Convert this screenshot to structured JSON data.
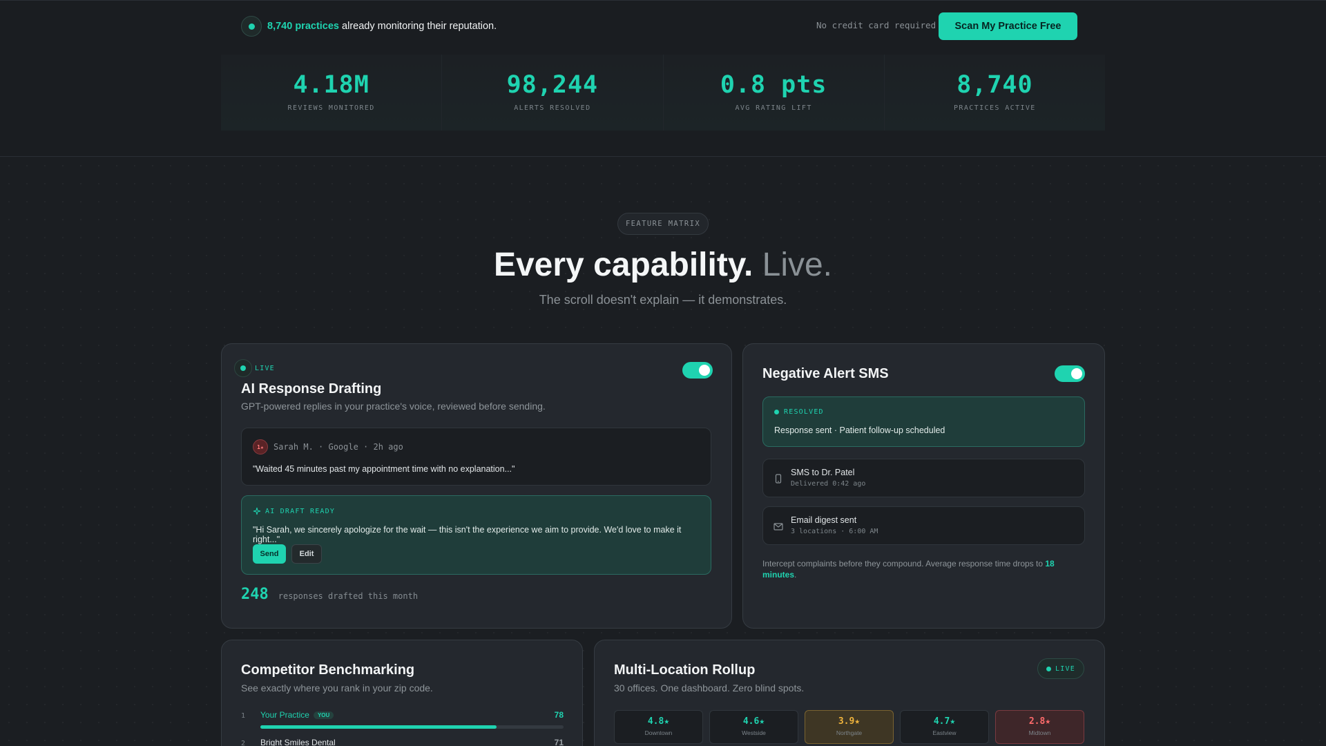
{
  "banner": {
    "practices_highlight": "8,740 practices",
    "practices_text": " already monitoring their reputation.",
    "no_card": "No credit card required",
    "cta": "Scan My Practice Free"
  },
  "stats": [
    {
      "value": "4.18M",
      "label": "REVIEWS MONITORED"
    },
    {
      "value": "98,244",
      "label": "ALERTS RESOLVED"
    },
    {
      "value": "0.8 pts",
      "label": "AVG RATING LIFT"
    },
    {
      "value": "8,740",
      "label": "PRACTICES ACTIVE"
    }
  ],
  "section": {
    "pill": "FEATURE MATRIX",
    "title_main": "Every capability.",
    "title_dim": " Live.",
    "subtitle": "The scroll doesn't explain — it demonstrates."
  },
  "ai_card": {
    "live": "LIVE",
    "title": "AI Response Drafting",
    "desc": "GPT-powered replies in your practice's voice, reviewed before sending.",
    "toggle_on": true,
    "review": {
      "avatar": "1★",
      "meta": "Sarah M. · Google · 2h ago",
      "quote": "\"Waited 45 minutes past my appointment time with no explanation...\""
    },
    "draft": {
      "header": "AI DRAFT READY",
      "text": "\"Hi Sarah, we sincerely apologize for the wait — this isn't the experience we aim to provide. We'd love to make it right...\"",
      "send": "Send",
      "edit": "Edit"
    },
    "count": "248",
    "count_label": "responses drafted this month"
  },
  "sms_card": {
    "title": "Negative Alert SMS",
    "toggle_on": true,
    "resolved_header": "RESOLVED",
    "resolved_text": "Response sent · Patient follow-up scheduled",
    "notifications": [
      {
        "icon": "phone-icon",
        "title": "SMS to Dr. Patel",
        "sub": "Delivered 0:42 ago"
      },
      {
        "icon": "mail-icon",
        "title": "Email digest sent",
        "sub": "3 locations · 6:00 AM"
      }
    ],
    "footer_text": "Intercept complaints before they compound. Average response time drops to ",
    "footer_highlight": "18 minutes",
    "footer_end": "."
  },
  "bench_card": {
    "title": "Competitor Benchmarking",
    "desc": "See exactly where you rank in your zip code.",
    "rows": [
      {
        "rank": "1",
        "name": "Your Practice",
        "badge": "YOU",
        "score": "78",
        "fill": 0.78,
        "highlight": true
      },
      {
        "rank": "2",
        "name": "Bright Smiles Dental",
        "score": "71",
        "fill": 0.71,
        "highlight": false
      }
    ]
  },
  "rollup_card": {
    "title": "Multi-Location Rollup",
    "desc": "30 offices. One dashboard. Zero blind spots.",
    "live": "LIVE",
    "locations": [
      {
        "rating": "4.8★",
        "name": "Downtown",
        "status": "good"
      },
      {
        "rating": "4.6★",
        "name": "Westside",
        "status": "good"
      },
      {
        "rating": "3.9★",
        "name": "Northgate",
        "status": "warn"
      },
      {
        "rating": "4.7★",
        "name": "Eastview",
        "status": "good"
      },
      {
        "rating": "2.8★",
        "name": "Midtown",
        "status": "bad"
      }
    ]
  },
  "colors": {
    "accent": "#1fd3b0",
    "warn": "#f0b43c",
    "bad": "#ff6b6b",
    "background": "#1b1e22"
  }
}
